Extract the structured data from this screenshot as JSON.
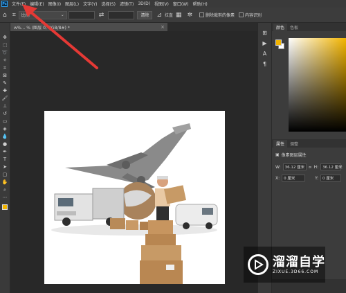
{
  "menubar": {
    "logo": "Ps",
    "items": [
      "文件(F)",
      "编辑(E)",
      "图像(I)",
      "图层(L)",
      "文字(Y)",
      "选择(S)",
      "滤镜(T)",
      "3D(D)",
      "视图(V)",
      "窗口(W)",
      "帮助(H)"
    ]
  },
  "options": {
    "style_value": "比例",
    "swap_icon": "swap-icon",
    "clear_button": "清除",
    "straighten_label": "拉直",
    "delete_cropped_label": "删除裁剪的像素",
    "content_aware_label": "内容识别"
  },
  "document": {
    "tab_title": "w%...  % (图层 0, RGB/8#) *",
    "close": "×"
  },
  "panels": {
    "color_tabs": [
      "颜色",
      "色板"
    ],
    "props_tabs": [
      "属性",
      "调整"
    ],
    "props_subtitle": "像素图层属性",
    "w_label": "W:",
    "w_value": "36.12 厘米",
    "h_label": "H:",
    "h_value": "36.12 厘米",
    "x_label": "X:",
    "x_value": "0 厘米",
    "y_label": "Y:",
    "y_value": "0 厘米",
    "fg_color": "#f2b400",
    "bg_color": "#ffffff"
  },
  "watermark": {
    "title": "溜溜自学",
    "subtitle": "ZIXUE.3D66.COM"
  },
  "annotation": {
    "arrow_color": "#e53935"
  }
}
